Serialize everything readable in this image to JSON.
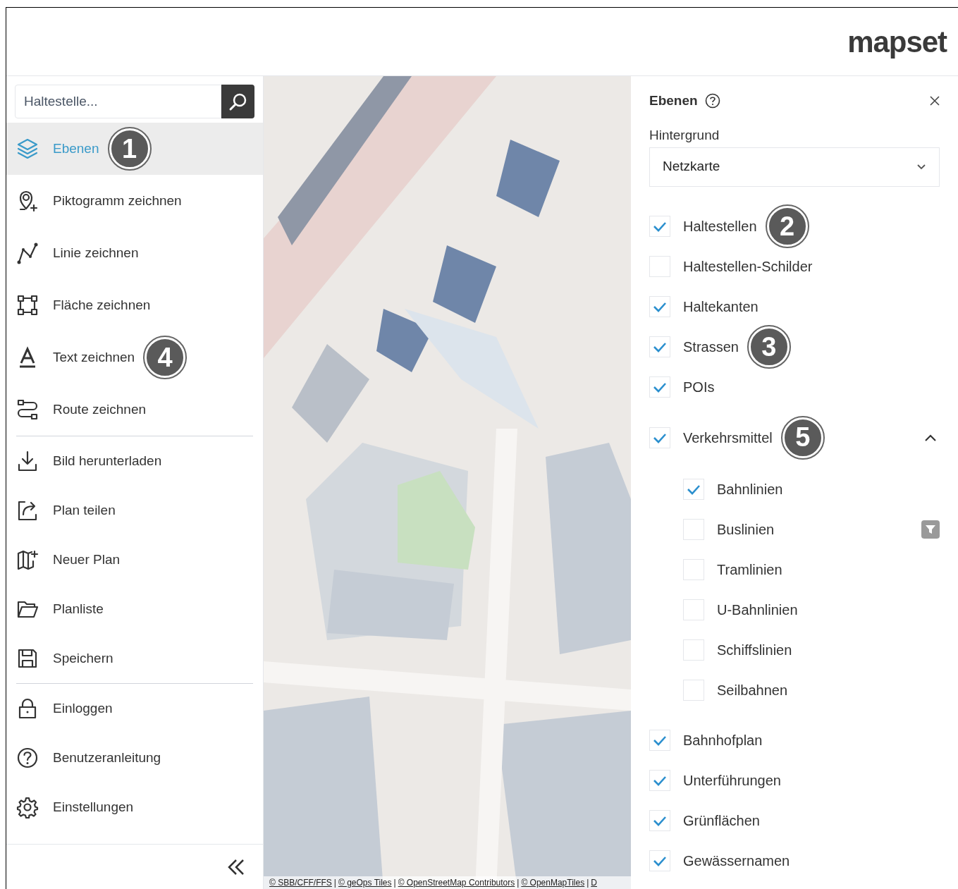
{
  "header": {
    "logo": "mapset"
  },
  "sidebar": {
    "search": {
      "placeholder": "Haltestelle..."
    },
    "groups": [
      [
        {
          "label": "Ebenen",
          "selected": true,
          "callout": "1"
        },
        {
          "label": "Piktogramm zeichnen",
          "selected": false
        },
        {
          "label": "Linie zeichnen",
          "selected": false
        },
        {
          "label": "Fläche zeichnen",
          "selected": false
        },
        {
          "label": "Text zeichnen",
          "selected": false,
          "callout": "4"
        },
        {
          "label": "Route zeichnen",
          "selected": false
        }
      ],
      [
        {
          "label": "Bild herunterladen",
          "selected": false
        },
        {
          "label": "Plan teilen",
          "selected": false
        },
        {
          "label": "Neuer Plan",
          "selected": false
        },
        {
          "label": "Planliste",
          "selected": false
        },
        {
          "label": "Speichern",
          "selected": false
        }
      ],
      [
        {
          "label": "Einloggen",
          "selected": false
        },
        {
          "label": "Benutzeranleitung",
          "selected": false
        },
        {
          "label": "Einstellungen",
          "selected": false
        }
      ]
    ]
  },
  "map": {
    "attribution": [
      {
        "kind": "link",
        "text": "© SBB/CFF/FFS"
      },
      {
        "kind": "separator",
        "text": "|"
      },
      {
        "kind": "link",
        "text": "© geOps Tiles"
      },
      {
        "kind": "separator",
        "text": "|"
      },
      {
        "kind": "link",
        "text": "© OpenStreetMap Contributors"
      },
      {
        "kind": "separator",
        "text": "|"
      },
      {
        "kind": "link",
        "text": "© OpenMapTiles"
      },
      {
        "kind": "separator",
        "text": "|"
      },
      {
        "kind": "link",
        "text": "D"
      }
    ]
  },
  "panel": {
    "title": "Ebenen",
    "background_label": "Hintergrund",
    "background_value": "Netzkarte",
    "layers": [
      {
        "label": "Haltestellen",
        "checked": true,
        "callout": "2"
      },
      {
        "label": "Haltestellen-Schilder",
        "checked": false
      },
      {
        "label": "Haltekanten",
        "checked": true
      },
      {
        "label": "Strassen",
        "checked": true,
        "callout": "3"
      },
      {
        "label": "POIs",
        "checked": true
      },
      {
        "label": "Verkehrsmittel",
        "checked": true,
        "callout": "5",
        "expanded": true,
        "children": [
          {
            "label": "Bahnlinien",
            "checked": true,
            "filter": false
          },
          {
            "label": "Buslinien",
            "checked": false,
            "filter": true
          },
          {
            "label": "Tramlinien",
            "checked": false,
            "filter": false
          },
          {
            "label": "U-Bahnlinien",
            "checked": false,
            "filter": false
          },
          {
            "label": "Schiffslinien",
            "checked": false,
            "filter": false
          },
          {
            "label": "Seilbahnen",
            "checked": false,
            "filter": false
          }
        ]
      },
      {
        "label": "Bahnhofplan",
        "checked": true
      },
      {
        "label": "Unterführungen",
        "checked": true
      },
      {
        "label": "Grünflächen",
        "checked": true
      },
      {
        "label": "Gewässernamen",
        "checked": true
      }
    ]
  }
}
